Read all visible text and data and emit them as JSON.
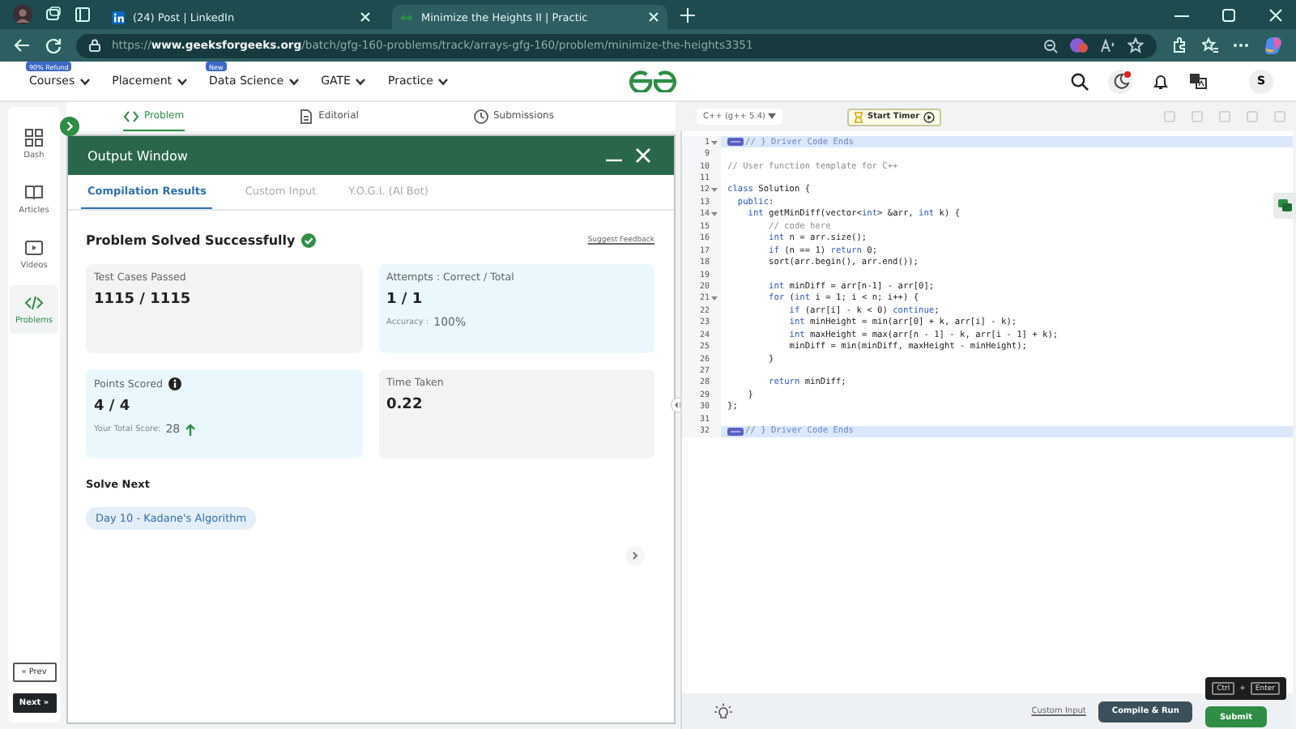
{
  "browser": {
    "tabs": [
      {
        "title": "(24) Post | LinkedIn",
        "selected": false
      },
      {
        "title": "Minimize the Heights II | Practic",
        "selected": true
      }
    ],
    "url": "https://**www.geeksforgeeks.org**/batch/gfg-160-problems/track/arrays-gfg-160/problem/minimize-the-heights3351"
  },
  "site_nav": {
    "menus": [
      {
        "label": "Courses",
        "badge": "90% Refund"
      },
      {
        "label": "Placement"
      },
      {
        "label": "Data Science",
        "badge": "New"
      },
      {
        "label": "GATE"
      },
      {
        "label": "Practice"
      }
    ],
    "avatar": "S"
  },
  "sidebar": {
    "items": [
      {
        "label": "Dash",
        "selected": false
      },
      {
        "label": "Articles",
        "selected": false
      },
      {
        "label": "Videos",
        "selected": false
      },
      {
        "label": "Problems",
        "selected": true
      }
    ],
    "prev": "« Prev",
    "next": "Next »"
  },
  "problem_tabs": [
    {
      "label": "Problem",
      "selected": true
    },
    {
      "label": "Editorial",
      "selected": false
    },
    {
      "label": "Submissions",
      "selected": false
    }
  ],
  "output_window": {
    "title": "Output Window",
    "tabs": [
      {
        "label": "Compilation Results",
        "selected": true
      },
      {
        "label": "Custom Input",
        "selected": false
      },
      {
        "label": "Y.O.G.I. (AI Bot)",
        "selected": false
      }
    ],
    "status": "Problem Solved Successfully",
    "feedback_link": "Suggest Feedback",
    "cards": [
      {
        "label": "Test Cases Passed",
        "value": "1115 / 1115"
      },
      {
        "label": "Attempts : Correct / Total",
        "value": "1 / 1",
        "note_label": "Accuracy :",
        "note_value": "100%"
      },
      {
        "label": "Points Scored",
        "info": true,
        "value": "4 / 4",
        "note_label": "Your Total Score:",
        "note_value": "28",
        "rising": true
      },
      {
        "label": "Time Taken",
        "value": "0.22"
      }
    ],
    "solve_next_heading": "Solve Next",
    "solve_next": [
      {
        "label": "Day 10 - Kadane's Algorithm"
      }
    ]
  },
  "editor": {
    "language": "C++ (g++ 5.4)",
    "timer_button": "Start Timer",
    "lines": [
      {
        "number": "1",
        "code": "// } Driver Code Ends",
        "kind": "comment",
        "highlighted": true,
        "foldable": true,
        "folded": true
      },
      {
        "number": "9",
        "highlighted": false,
        "foldable": false,
        "folded": false
      },
      {
        "number": "10",
        "code": "// User function template for C++",
        "kind": "comment",
        "highlighted": false,
        "foldable": false,
        "folded": false
      },
      {
        "number": "11",
        "highlighted": false,
        "foldable": false,
        "folded": false
      },
      {
        "number": "12",
        "code": "class Solution {",
        "kind": "code",
        "highlighted": false,
        "foldable": true,
        "folded": false
      },
      {
        "number": "13",
        "code": "  public:",
        "kind": "code",
        "highlighted": false,
        "foldable": false,
        "folded": false
      },
      {
        "number": "14",
        "code": "    int getMinDiff(vector<int> &arr, int k) {",
        "kind": "code",
        "highlighted": false,
        "foldable": true,
        "folded": false
      },
      {
        "number": "15",
        "code": "        // code here",
        "kind": "comment",
        "highlighted": false,
        "foldable": false,
        "folded": false
      },
      {
        "number": "16",
        "code": "        int n = arr.size();",
        "kind": "code",
        "highlighted": false,
        "foldable": false,
        "folded": false
      },
      {
        "number": "17",
        "code": "        if (n == 1) return 0;",
        "kind": "code",
        "highlighted": false,
        "foldable": false,
        "folded": false
      },
      {
        "number": "18",
        "code": "        sort(arr.begin(), arr.end());",
        "kind": "code",
        "highlighted": false,
        "foldable": false,
        "folded": false
      },
      {
        "number": "19",
        "highlighted": false,
        "foldable": false,
        "folded": false
      },
      {
        "number": "20",
        "code": "        int minDiff = arr[n-1] - arr[0];",
        "kind": "code",
        "highlighted": false,
        "foldable": false,
        "folded": false
      },
      {
        "number": "21",
        "code": "        for (int i = 1; i < n; i++) {",
        "kind": "code",
        "highlighted": false,
        "foldable": true,
        "folded": false
      },
      {
        "number": "22",
        "code": "            if (arr[i] - k < 0) continue;",
        "kind": "code",
        "highlighted": false,
        "foldable": false,
        "folded": false
      },
      {
        "number": "23",
        "code": "            int minHeight = min(arr[0] + k, arr[i] - k);",
        "kind": "code",
        "highlighted": false,
        "foldable": false,
        "folded": false
      },
      {
        "number": "24",
        "code": "            int maxHeight = max(arr[n - 1] - k, arr[i - 1] + k);",
        "kind": "code",
        "highlighted": false,
        "foldable": false,
        "folded": false
      },
      {
        "number": "25",
        "code": "            minDiff = min(minDiff, maxHeight - minHeight);",
        "kind": "code",
        "highlighted": false,
        "foldable": false,
        "folded": false
      },
      {
        "number": "26",
        "code": "        }",
        "kind": "code",
        "highlighted": false,
        "foldable": false,
        "folded": false
      },
      {
        "number": "27",
        "highlighted": false,
        "foldable": false,
        "folded": false
      },
      {
        "number": "28",
        "code": "        return minDiff;",
        "kind": "code",
        "highlighted": false,
        "foldable": false,
        "folded": false
      },
      {
        "number": "29",
        "code": "    }",
        "kind": "code",
        "highlighted": false,
        "foldable": false,
        "folded": false
      },
      {
        "number": "30",
        "code": "};",
        "kind": "code",
        "highlighted": false,
        "foldable": false,
        "folded": false
      },
      {
        "number": "31",
        "highlighted": false,
        "foldable": false,
        "folded": false
      },
      {
        "number": "32",
        "code": "// } Driver Code Ends",
        "kind": "comment",
        "highlighted": true,
        "foldable": false,
        "folded": true
      }
    ],
    "custom_input": "Custom Input",
    "compile_button": "Compile & Run",
    "submit_button": "Submit",
    "shortcut": {
      "keys": [
        "Ctrl",
        "Enter"
      ],
      "joiner": "+"
    }
  }
}
